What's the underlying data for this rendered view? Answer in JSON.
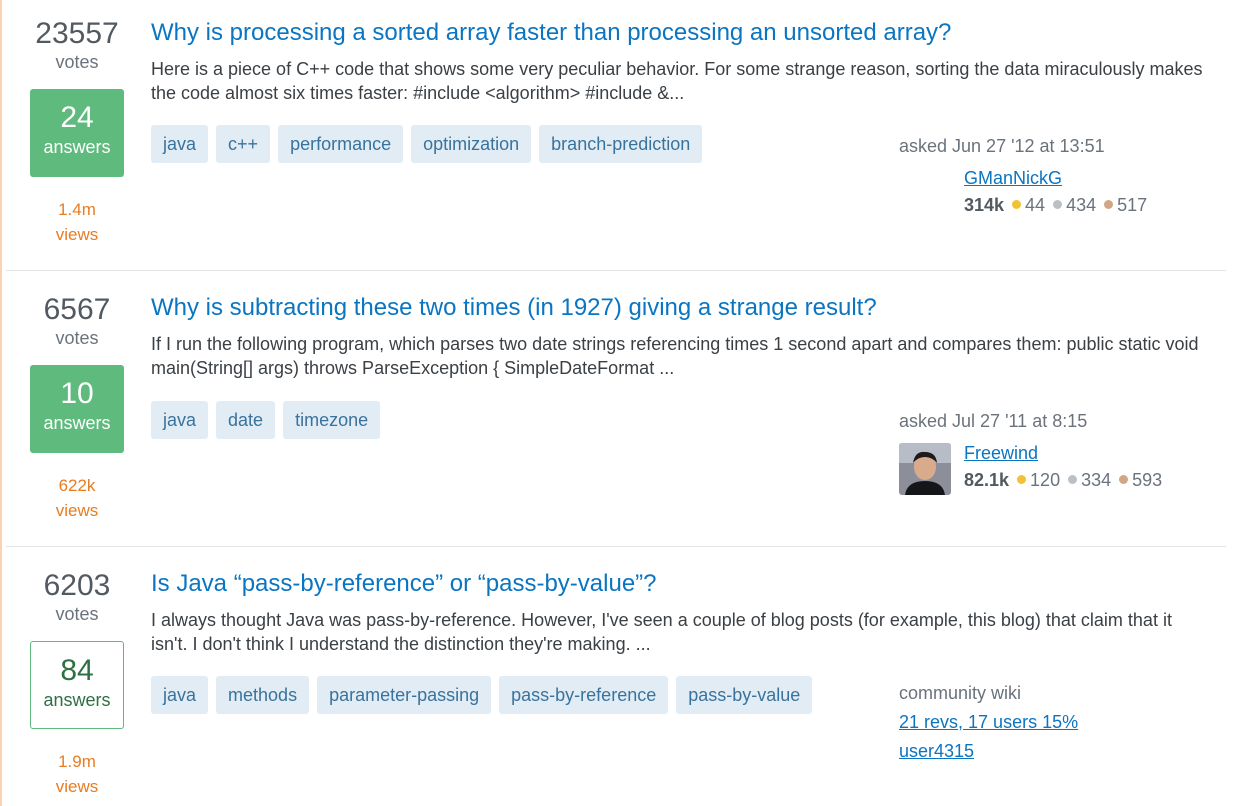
{
  "questions": [
    {
      "votes": "23557",
      "votes_label": "votes",
      "answers": "24",
      "answers_label": "answers",
      "accepted": true,
      "views": "1.4m",
      "views_label": "views",
      "title": "Why is processing a sorted array faster than processing an unsorted array?",
      "excerpt": "Here is a piece of C++ code that shows some very peculiar behavior. For some strange reason, sorting the data miraculously makes the code almost six times faster: #include <algorithm> #include &...",
      "tags": [
        "java",
        "c++",
        "performance",
        "optimization",
        "branch-prediction"
      ],
      "asked": "asked Jun 27 '12 at 13:51",
      "user": {
        "name": "GManNickG",
        "rep": "314k",
        "gold": "44",
        "silver": "434",
        "bronze": "517",
        "avatar": "none"
      }
    },
    {
      "votes": "6567",
      "votes_label": "votes",
      "answers": "10",
      "answers_label": "answers",
      "accepted": true,
      "views": "622k",
      "views_label": "views",
      "title": "Why is subtracting these two times (in 1927) giving a strange result?",
      "excerpt": "If I run the following program, which parses two date strings referencing times 1 second apart and compares them: public static void main(String[] args) throws ParseException { SimpleDateFormat ...",
      "tags": [
        "java",
        "date",
        "timezone"
      ],
      "asked": "asked Jul 27 '11 at 8:15",
      "user": {
        "name": "Freewind",
        "rep": "82.1k",
        "gold": "120",
        "silver": "334",
        "bronze": "593",
        "avatar": "photo"
      }
    },
    {
      "votes": "6203",
      "votes_label": "votes",
      "answers": "84",
      "answers_label": "answers",
      "accepted": false,
      "views": "1.9m",
      "views_label": "views",
      "title": "Is Java “pass-by-reference” or “pass-by-value”?",
      "excerpt": "I always thought Java was pass-by-reference. However, I've seen a couple of blog posts (for example, this blog) that claim that it isn't. I don't think I understand the distinction they're making. ...",
      "tags": [
        "java",
        "methods",
        "parameter-passing",
        "pass-by-reference",
        "pass-by-value"
      ],
      "community": {
        "label": "community wiki",
        "revs": "21 revs, 17 users 15%",
        "user": "user4315"
      }
    }
  ],
  "colors": {
    "link": "#0a75c2",
    "accepted_bg": "#5eba7d",
    "views": "#e87c21",
    "tag_bg": "#e1ecf4",
    "tag_text": "#39739d"
  }
}
